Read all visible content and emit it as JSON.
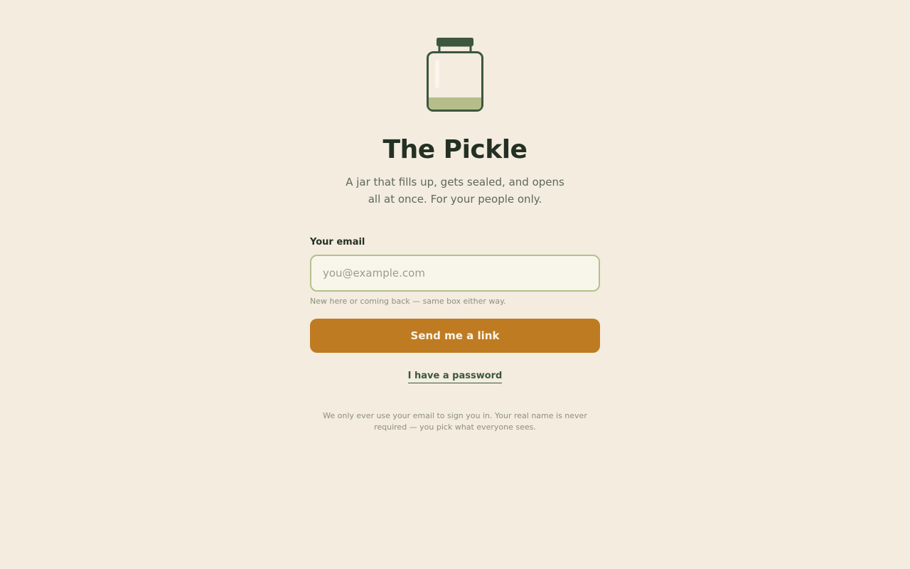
{
  "brand": {
    "icon": "pickle-jar-icon",
    "title": "The Pickle",
    "tagline": "A jar that fills up, gets sealed, and opens all at once. For your people only."
  },
  "login_form": {
    "email_label": "Your email",
    "email_value": "",
    "email_placeholder": "you@example.com",
    "email_hint": "New here or coming back — same box either way.",
    "submit_label": "Send me a link",
    "password_link_label": "I have a password"
  },
  "footer": {
    "privacy_note": "We only ever use your email to sign you in. Your real name is never required — you pick what everyone sees."
  },
  "colors": {
    "background": "#f3ecdf",
    "jar_outline": "#3d573e",
    "jar_fill": "#b5be8b",
    "accent": "#bf7b22",
    "heading": "#243024"
  }
}
